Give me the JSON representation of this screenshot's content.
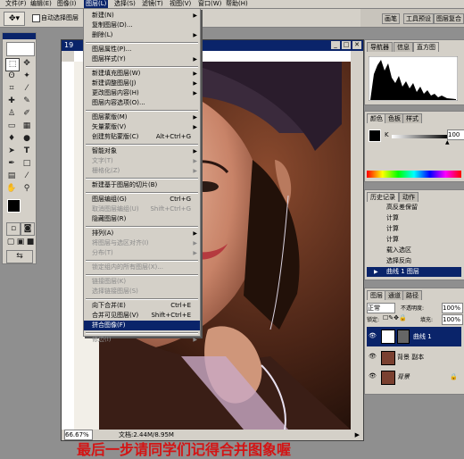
{
  "menubar": {
    "items": [
      "文件(F)",
      "编辑(E)",
      "图像(I)",
      "图层(L)",
      "选择(S)",
      "滤镜(T)",
      "视图(V)",
      "窗口(W)",
      "帮助(H)"
    ],
    "active_index": 3
  },
  "options_bar": {
    "auto_select_label": "自动选择图层",
    "auto_select_checked": false,
    "tab_brushes": "画笔",
    "tab_tool_presets": "工具预设",
    "tab_layer_comps": "图层复合"
  },
  "document": {
    "title": "19",
    "zoom": "66.67%",
    "doc_info": "文档:2.44M/8.95M"
  },
  "layer_menu": {
    "items": [
      {
        "label": "新建(N)",
        "submenu": true
      },
      {
        "label": "复制图层(D)..."
      },
      {
        "label": "删除(L)",
        "submenu": true
      },
      {
        "sep": true
      },
      {
        "label": "图层属性(P)..."
      },
      {
        "label": "图层样式(Y)",
        "submenu": true
      },
      {
        "sep": true
      },
      {
        "label": "新建填充图层(W)",
        "submenu": true
      },
      {
        "label": "新建调整图层(J)",
        "submenu": true
      },
      {
        "label": "更改图层内容(H)",
        "submenu": true
      },
      {
        "label": "图层内容选项(O)..."
      },
      {
        "sep": true
      },
      {
        "label": "图层蒙版(M)",
        "submenu": true
      },
      {
        "label": "矢量蒙版(V)",
        "submenu": true
      },
      {
        "label": "创建剪贴蒙版(C)",
        "shortcut": "Alt+Ctrl+G"
      },
      {
        "sep": true
      },
      {
        "label": "智能对象",
        "submenu": true
      },
      {
        "label": "文字(T)",
        "submenu": true,
        "disabled": true
      },
      {
        "label": "栅格化(Z)",
        "submenu": true,
        "disabled": true
      },
      {
        "sep": true
      },
      {
        "label": "新建基于图层的切片(B)"
      },
      {
        "sep": true
      },
      {
        "label": "图层编组(G)",
        "shortcut": "Ctrl+G"
      },
      {
        "label": "取消图层编组(U)",
        "shortcut": "Shift+Ctrl+G",
        "disabled": true
      },
      {
        "label": "隐藏图层(R)"
      },
      {
        "sep": true
      },
      {
        "label": "排列(A)",
        "submenu": true
      },
      {
        "label": "将图层与选区对齐(I)",
        "submenu": true,
        "disabled": true
      },
      {
        "label": "分布(T)",
        "submenu": true,
        "disabled": true
      },
      {
        "sep": true
      },
      {
        "label": "锁定组内的所有图层(X)...",
        "disabled": true
      },
      {
        "sep": true
      },
      {
        "label": "链接图层(K)",
        "disabled": true
      },
      {
        "label": "选择链接图层(S)",
        "disabled": true
      },
      {
        "sep": true
      },
      {
        "label": "向下合并(E)",
        "shortcut": "Ctrl+E"
      },
      {
        "label": "合并可见图层(V)",
        "shortcut": "Shift+Ctrl+E"
      },
      {
        "label": "拼合图像(F)",
        "highlighted": true
      },
      {
        "sep": true
      },
      {
        "label": "修边(I)",
        "submenu": true,
        "disabled": true
      }
    ]
  },
  "navigator_panel": {
    "tabs": [
      "导航器",
      "信息",
      "直方图"
    ],
    "active_tab": 2
  },
  "color_panel": {
    "tabs": [
      "颜色",
      "色板",
      "样式"
    ],
    "channel_label": "K",
    "value": "100",
    "foreground": "#000000",
    "background": "#ffffff"
  },
  "history_panel": {
    "tabs": [
      "历史记录",
      "动作"
    ],
    "items": [
      "高反差保留",
      "计算",
      "计算",
      "计算",
      "载入选区",
      "选择反向",
      "曲线 1 图层"
    ],
    "selected_index": 6
  },
  "layers_panel": {
    "tabs": [
      "图层",
      "通道",
      "路径"
    ],
    "blend_mode": "正常",
    "opacity_label": "不透明度:",
    "opacity_value": "100%",
    "lock_label": "锁定:",
    "fill_label": "填充:",
    "fill_value": "100%",
    "layers": [
      {
        "name": "曲线 1",
        "selected": true
      },
      {
        "name": "背景 副本",
        "selected": false
      },
      {
        "name": "背景",
        "selected": false
      }
    ]
  },
  "caption": "最后一步请同学们记得合并图象喔",
  "colors": {
    "chrome": "#d4d0c8",
    "highlight": "#0a246a",
    "caption": "#d41414"
  }
}
